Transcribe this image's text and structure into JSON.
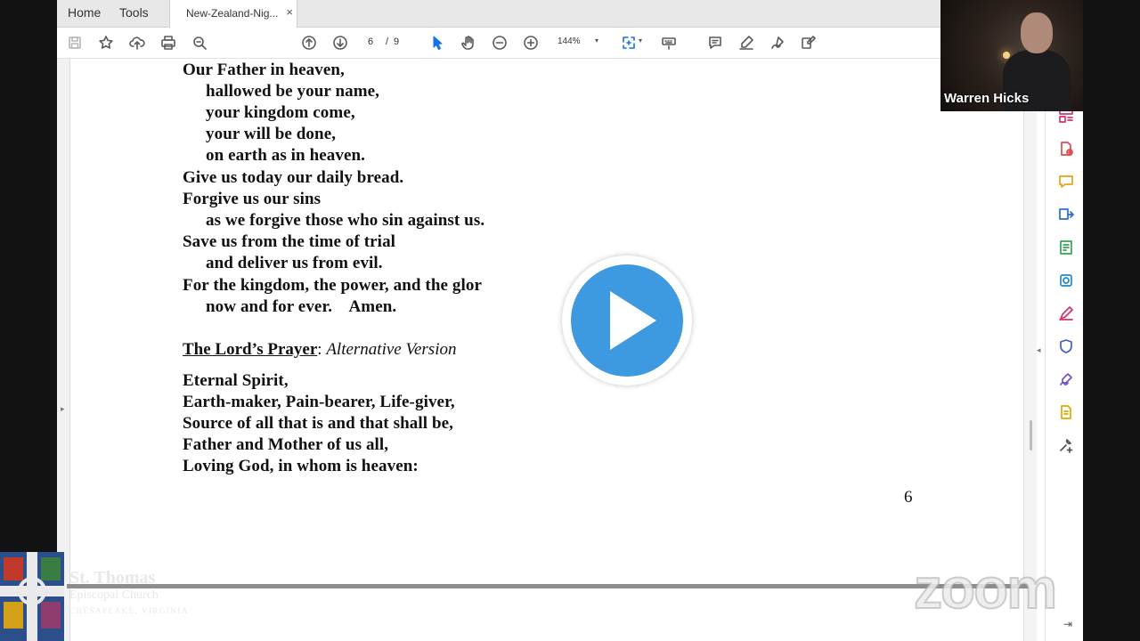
{
  "tabs": {
    "home": "Home",
    "tools": "Tools",
    "document": "New-Zealand-Nig...",
    "close": "×"
  },
  "toolbar": {
    "current_page": "6",
    "page_separator": "/",
    "total_pages": "9",
    "zoom_level": "144%",
    "accent": "#1473e6"
  },
  "document": {
    "prayer_lines": [
      "Our Father in heaven,",
      "hallowed be your name,",
      "your kingdom come,",
      "your will be done,",
      "on earth as in heaven.",
      "Give us today our daily bread.",
      "Forgive us our sins",
      "as we forgive those who sin against us.",
      "Save us from the time of trial",
      "and deliver us from evil.",
      "For the kingdom, the power, and the glor",
      "now and for ever.    Amen."
    ],
    "heading_title": "The Lord’s Prayer",
    "heading_sep": ": ",
    "heading_subtitle": "Alternative Version",
    "alt_lines": [
      "Eternal Spirit,",
      "Earth-maker, Pain-bearer, Life-giver,",
      "Source of all that is and that shall be,",
      "Father and Mother of us all,",
      "Loving God, in whom is heaven:"
    ],
    "page_number": "6"
  },
  "video": {
    "participant_name": "Warren Hicks"
  },
  "overlay": {
    "play_color": "#3d9ae0",
    "zoom_watermark": "zoom"
  },
  "church": {
    "name1": "St. Thomas",
    "name2": "Episcopal Church",
    "place": "CHESAPEAKE, VIRGINIA"
  },
  "icons": [
    "save-icon",
    "bookmark-star-icon",
    "upload-icon",
    "print-icon",
    "zoom-search-icon",
    "page-up-icon",
    "page-down-icon",
    "select-cursor-icon",
    "hand-pan-icon",
    "zoom-out-icon",
    "zoom-in-icon",
    "marquee-zoom-icon",
    "keyboard-icon",
    "comment-icon",
    "highlight-pen-icon",
    "sign-icon",
    "fill-sign-icon"
  ]
}
